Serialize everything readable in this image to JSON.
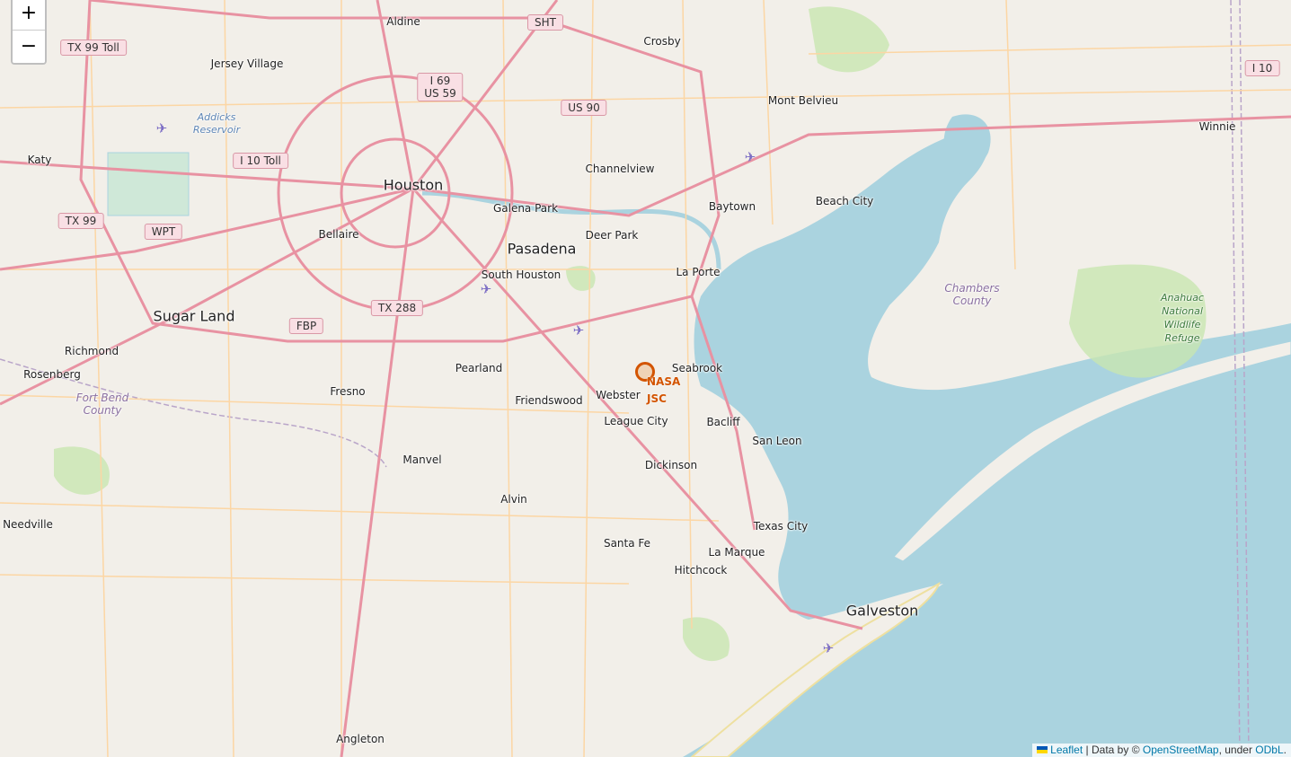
{
  "map": {
    "places": {
      "houston": "Houston",
      "pasadena": "Pasadena",
      "sugar_land": "Sugar Land",
      "galveston": "Galveston",
      "aldine": "Aldine",
      "crosby": "Crosby",
      "jersey_village": "Jersey Village",
      "mont_belvieu": "Mont Belvieu",
      "winnie": "Winnie",
      "katy": "Katy",
      "channelview": "Channelview",
      "baytown": "Baytown",
      "beach_city": "Beach City",
      "galena_park": "Galena Park",
      "deer_park": "Deer Park",
      "bellaire": "Bellaire",
      "south_houston": "South Houston",
      "la_porte": "La Porte",
      "richmond": "Richmond",
      "rosenberg": "Rosenberg",
      "fresno": "Fresno",
      "pearland": "Pearland",
      "seabrook": "Seabrook",
      "friendswood": "Friendswood",
      "webster": "Webster",
      "league_city": "League City",
      "bacliff": "Bacliff",
      "san_leon": "San Leon",
      "manvel": "Manvel",
      "dickinson": "Dickinson",
      "alvin": "Alvin",
      "needville": "Needville",
      "texas_city": "Texas City",
      "santa_fe": "Santa Fe",
      "la_marque": "La Marque",
      "hitchcock": "Hitchcock",
      "angleton": "Angleton"
    },
    "regions": {
      "fort_bend_1": "Fort Bend",
      "fort_bend_2": "County",
      "chambers_1": "Chambers",
      "chambers_2": "County"
    },
    "water": {
      "addicks_1": "Addicks",
      "addicks_2": "Reservoir"
    },
    "refuge": {
      "line1": "Anahuac",
      "line2": "National",
      "line3": "Wildlife",
      "line4": "Refuge"
    },
    "shields": {
      "tx99toll": "TX 99 Toll",
      "sht": "SHT",
      "i69": "I 69",
      "us59": "US 59",
      "us90": "US 90",
      "i10": "I 10",
      "i10toll": "I 10 Toll",
      "tx99": "TX 99",
      "wpt": "WPT",
      "tx288": "TX 288",
      "fbp": "FBP"
    },
    "marker": {
      "label_line1": "NASA",
      "label_line2": "JSC",
      "color": "#d35400"
    },
    "colors": {
      "land": "#f2efe9",
      "water": "#aad3df",
      "motorway": "#e892a2",
      "primary": "#fcd6a4"
    }
  },
  "zoom": {
    "in_label": "+",
    "out_label": "−"
  },
  "attribution": {
    "leaflet": "Leaflet",
    "separator": "|",
    "data_by": "Data by ©",
    "osm": "OpenStreetMap",
    "under": ", under",
    "odbl": "ODbL",
    "end": "."
  },
  "icons": [
    "airport-icon",
    "flag-icon"
  ]
}
